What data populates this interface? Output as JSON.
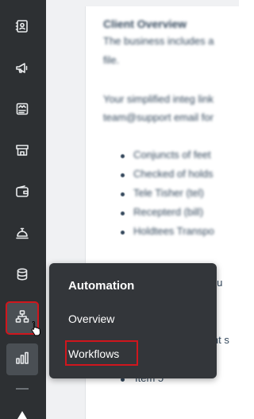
{
  "sidebar": {
    "items": [
      {
        "icon": "contacts-icon"
      },
      {
        "icon": "marketing-megaphone-icon"
      },
      {
        "icon": "content-icon"
      },
      {
        "icon": "commerce-store-icon"
      },
      {
        "icon": "wallet-icon"
      },
      {
        "icon": "service-bell-icon"
      },
      {
        "icon": "data-database-icon"
      },
      {
        "icon": "automation-flow-icon"
      },
      {
        "icon": "reporting-chart-icon"
      }
    ]
  },
  "flyout": {
    "title": "Automation",
    "items": [
      "Overview",
      "Workflows"
    ]
  },
  "document": {
    "visible_fragments": [
      "g (u",
      "int s",
      "Item 5"
    ]
  },
  "colors": {
    "sidebar_bg": "#2d3033",
    "flyout_bg": "#33363a",
    "highlight": "#d0161d"
  }
}
